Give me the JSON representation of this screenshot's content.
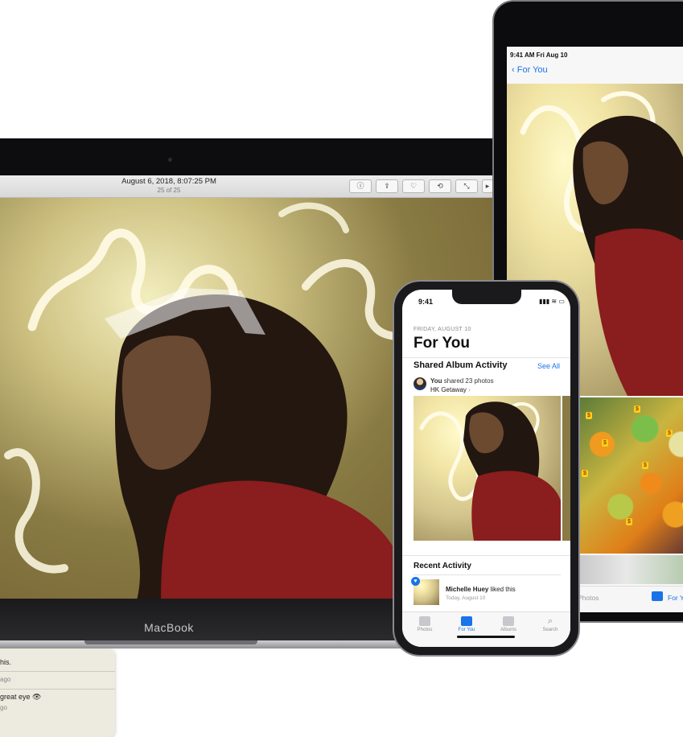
{
  "macbook": {
    "brand": "MacBook",
    "photo_title": "August 6, 2018, 8:07:25 PM",
    "photo_counter": "25 of 25",
    "toolbar_icons": [
      "info-icon",
      "share-icon",
      "heart-icon",
      "rotate-icon",
      "edit-icon",
      "slideshow-icon"
    ],
    "comments": [
      {
        "text": "his.",
        "time": "ago"
      },
      {
        "text": "great eye 👁",
        "time": "go"
      }
    ]
  },
  "ipad": {
    "status_time": "9:41 AM  Fri Aug 10",
    "back_label": "For You",
    "tabs": {
      "photos": "Photos",
      "for_you": "For Y"
    }
  },
  "iphone": {
    "status_time": "9:41",
    "date": "FRIDAY, AUGUST 10",
    "title": "For You",
    "section": "Shared Album Activity",
    "see_all": "See All",
    "shared_user": "You",
    "shared_text": "shared 23 photos",
    "album_name": "HK Getaway",
    "recent_title": "Recent Activity",
    "recent_user": "Michelle Huey",
    "recent_action": "liked this",
    "recent_time": "Today, August 10",
    "tabs": [
      "Photos",
      "For You",
      "Albums",
      "Search"
    ],
    "accent": "#1a73e8"
  }
}
